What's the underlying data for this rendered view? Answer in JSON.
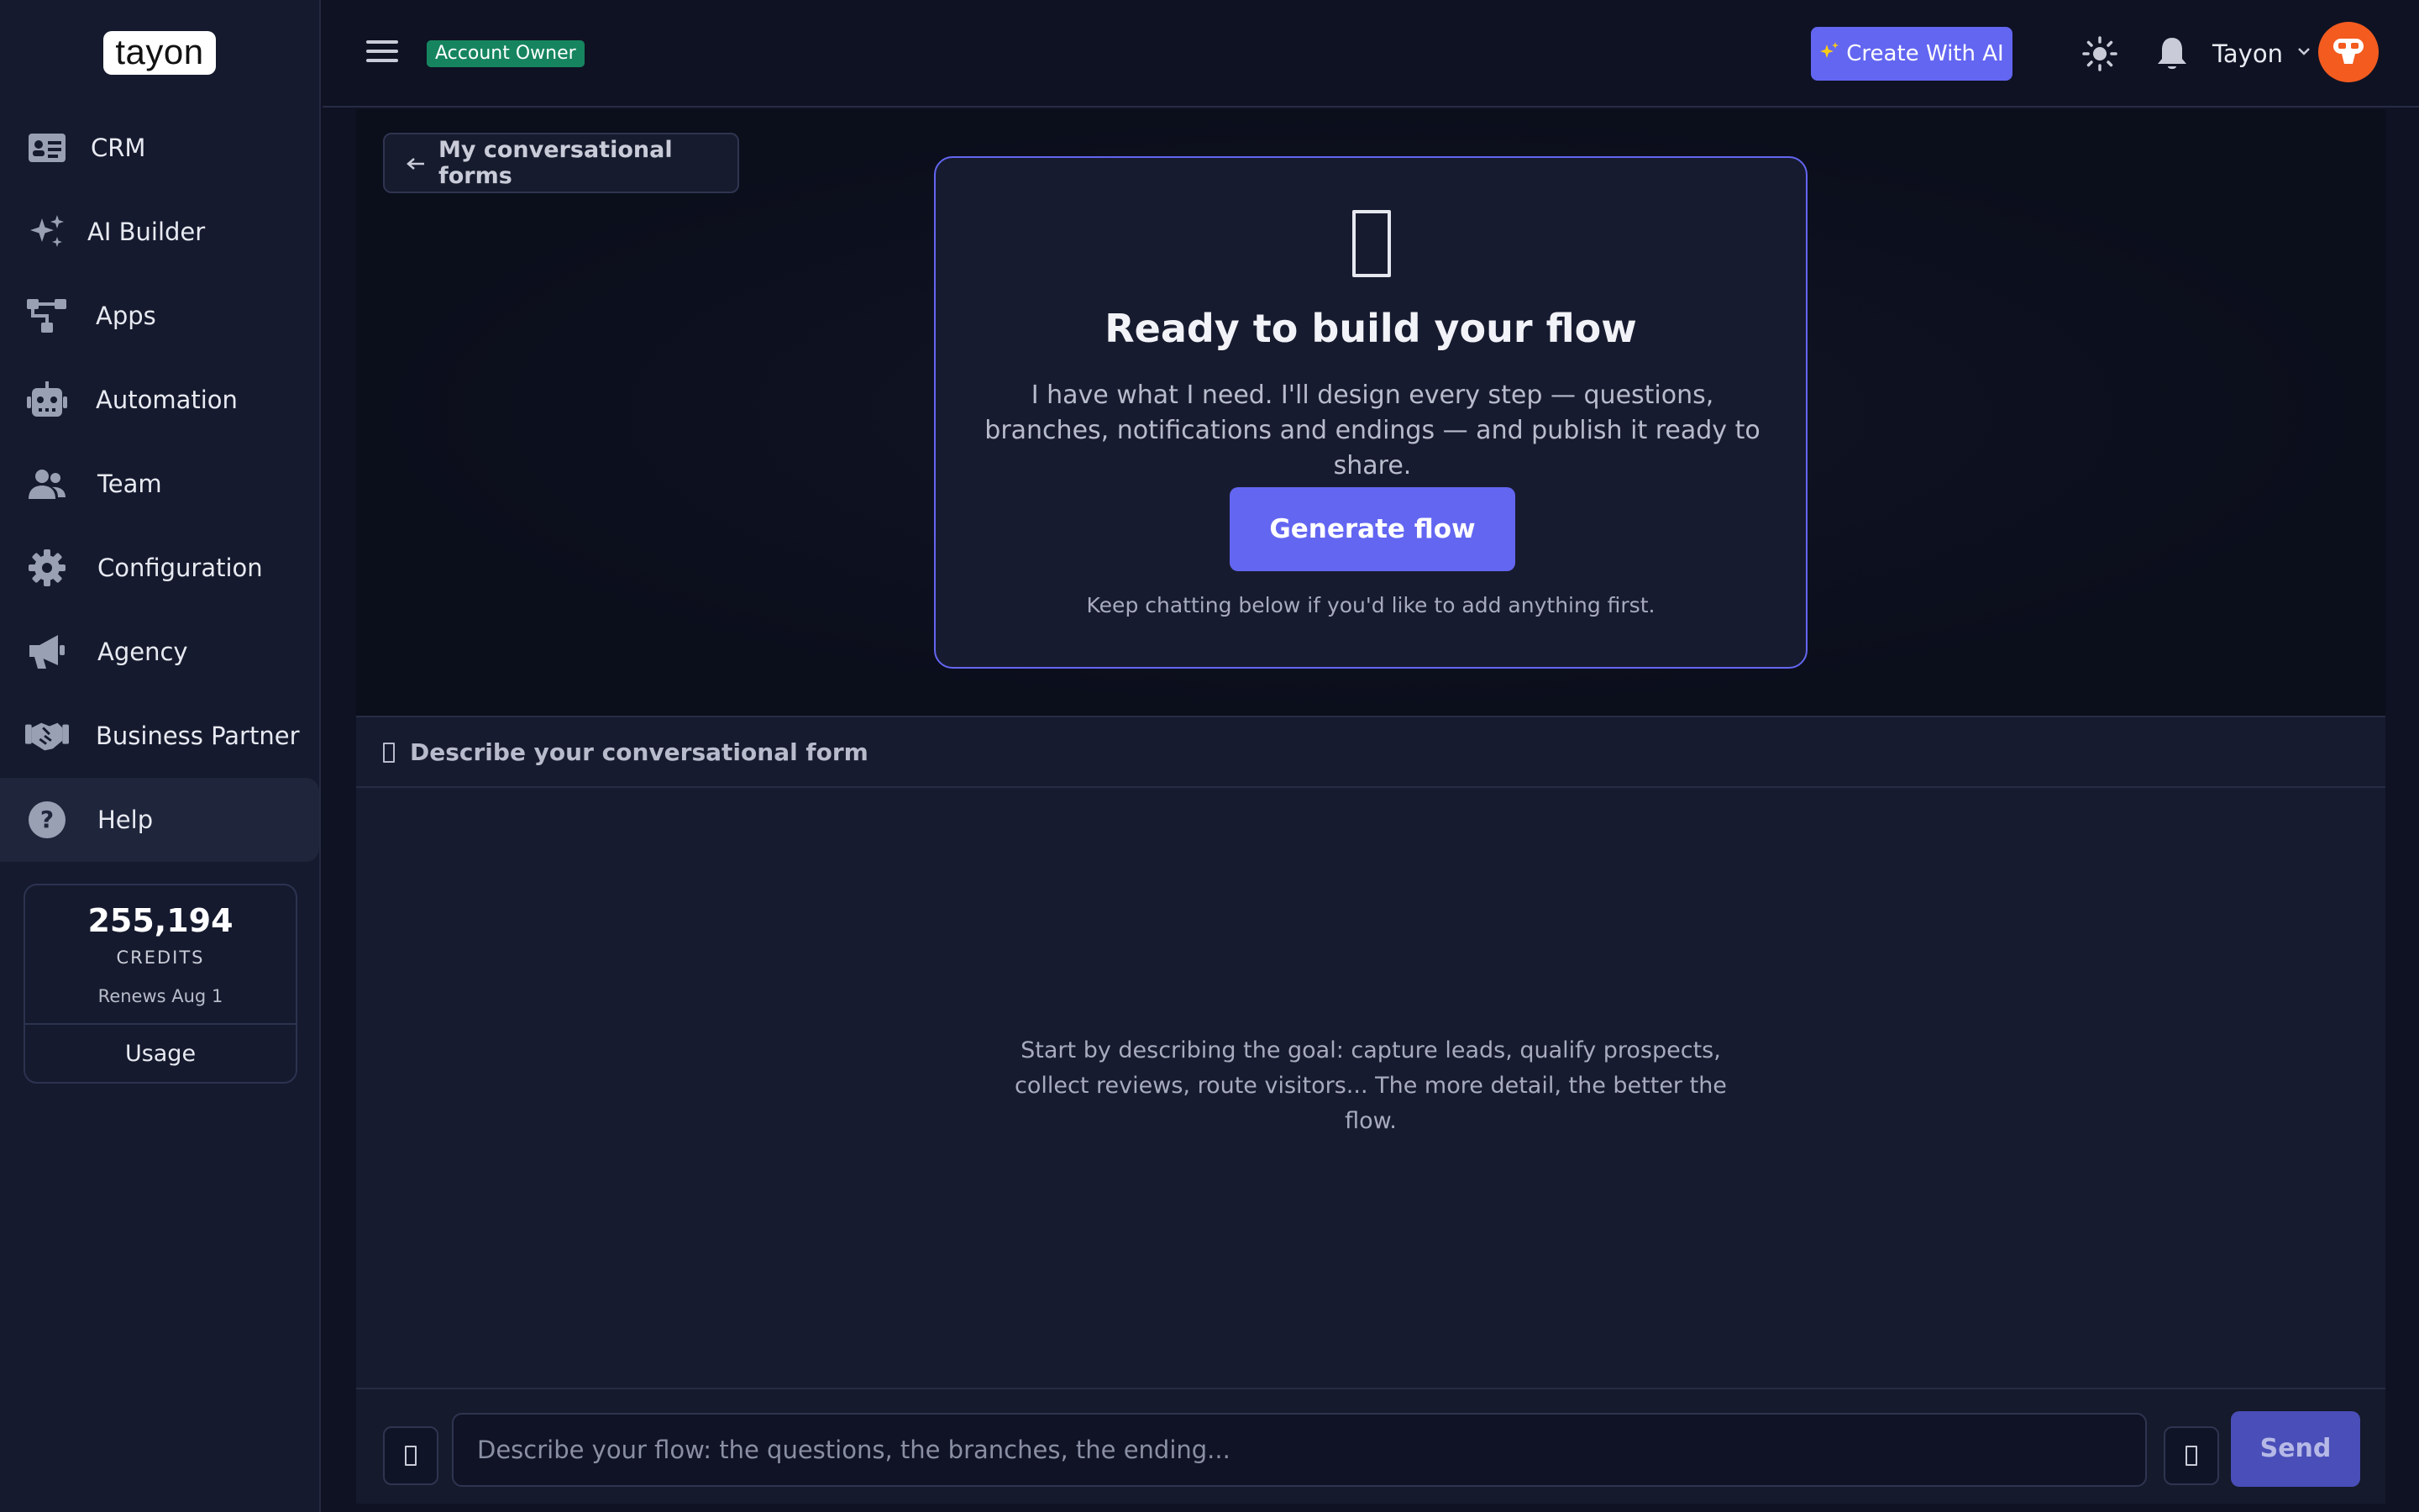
{
  "brand": {
    "logo_text": "tayon"
  },
  "sidebar": {
    "items": [
      {
        "label": "CRM",
        "icon": "id-card-icon"
      },
      {
        "label": "AI Builder",
        "icon": "sparkles-icon"
      },
      {
        "label": "Apps",
        "icon": "flow-icon"
      },
      {
        "label": "Automation",
        "icon": "robot-icon"
      },
      {
        "label": "Team",
        "icon": "users-icon"
      },
      {
        "label": "Configuration",
        "icon": "gear-icon"
      },
      {
        "label": "Agency",
        "icon": "megaphone-icon"
      },
      {
        "label": "Business Partner",
        "icon": "handshake-icon"
      },
      {
        "label": "Help",
        "icon": "question-circle-icon",
        "active": true
      }
    ],
    "credits": {
      "amount": "255,194",
      "label": "CREDITS",
      "renews": "Renews Aug 1",
      "usage_label": "Usage"
    }
  },
  "topbar": {
    "role_badge": "Account Owner",
    "create_ai_label": "Create With AI",
    "user_name": "Tayon"
  },
  "main": {
    "back_label": "My conversational forms",
    "ready": {
      "title": "Ready to build your flow",
      "description": "I have what I need. I'll design every step — questions, branches, notifications and endings — and publish it ready to share.",
      "button_label": "Generate flow",
      "note": "Keep chatting below if you'd like to add anything first."
    },
    "chat": {
      "title": "Describe your conversational form",
      "empty_text": "Start by describing the goal: capture leads, qualify prospects, collect reviews, route visitors... The more detail, the better the flow.",
      "input_placeholder": "Describe your flow: the questions, the branches, the ending...",
      "input_value": "",
      "send_label": "Send"
    }
  },
  "colors": {
    "accent": "#6366f1",
    "badge": "#16855f",
    "avatar": "#f35b1f",
    "background": "#0f1223",
    "sidebar": "#151a2e"
  }
}
